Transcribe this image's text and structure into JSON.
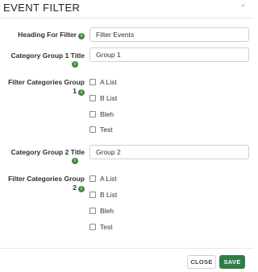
{
  "modal": {
    "title": "EVENT FILTER",
    "close_glyph": "×"
  },
  "fields": {
    "heading": {
      "label": "Heading For Filter",
      "value": "Filter Events"
    },
    "group1_title": {
      "label": "Category Group 1 Title",
      "value": "Group 1"
    },
    "group1_categories": {
      "label_line1": "Filter Categories Group",
      "label_line2": "1",
      "options": [
        "A List",
        "B List",
        "Bleh",
        "Test"
      ]
    },
    "group2_title": {
      "label": "Category Group 2 Title",
      "value": "Group 2"
    },
    "group2_categories": {
      "label_line1": "Filter Categories Group",
      "label_line2": "2",
      "options": [
        "A List",
        "B List",
        "Bleh",
        "Test"
      ]
    }
  },
  "footer": {
    "close_label": "CLOSE",
    "save_label": "SAVE"
  },
  "icons": {
    "info": "info-circle-icon",
    "close": "close-icon"
  },
  "colors": {
    "accent_green": "#2f7d46",
    "info_green": "#3d8b3d"
  }
}
